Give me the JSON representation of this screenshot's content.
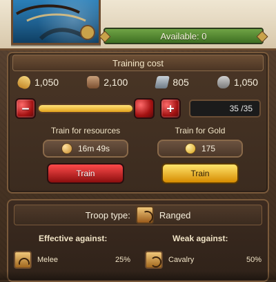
{
  "header": {
    "available_label": "Available: 0"
  },
  "training_cost": {
    "title": "Training cost",
    "resources": [
      {
        "icon": "wheat-icon",
        "value": "1,050"
      },
      {
        "icon": "wood-logs-icon",
        "value": "2,100"
      },
      {
        "icon": "iron-ingot-icon",
        "value": "805"
      },
      {
        "icon": "stone-icon",
        "value": "1,050"
      }
    ],
    "slider": {
      "fill_fraction": 1.0,
      "count_text": "35 /35"
    }
  },
  "train_options": {
    "resources": {
      "title": "Train for resources",
      "time": "16m 49s",
      "button_label": "Train"
    },
    "gold": {
      "title": "Train for Gold",
      "cost": "175",
      "button_label": "Train"
    }
  },
  "troop": {
    "type_label": "Troop type:",
    "type_value": "Ranged"
  },
  "effectiveness": {
    "effective_title": "Effective against:",
    "weak_title": "Weak against:",
    "effective": [
      {
        "name": "Melee",
        "percent": "25%"
      }
    ],
    "weak": [
      {
        "name": "Cavalry",
        "percent": "50%"
      }
    ]
  }
}
